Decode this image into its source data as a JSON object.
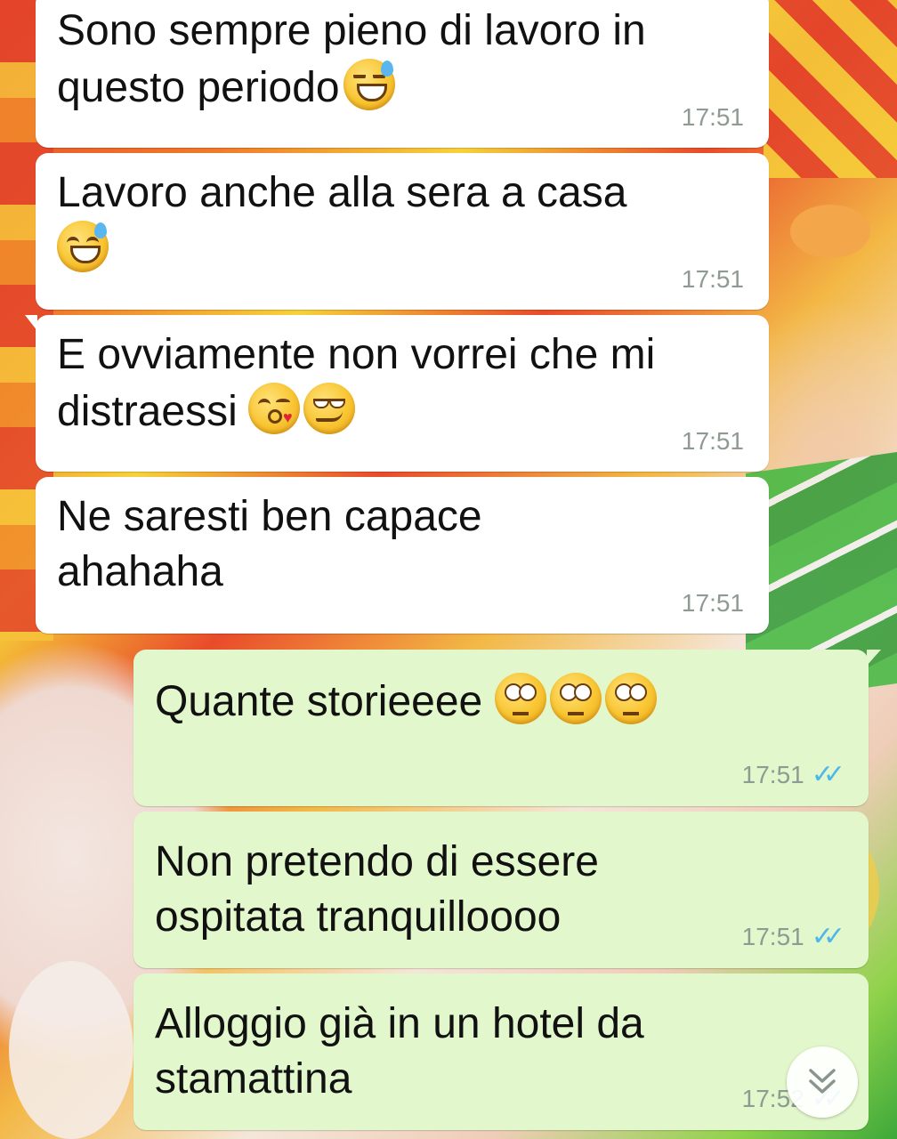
{
  "messages": [
    {
      "direction": "incoming",
      "text": "Sono sempre pieno di lavoro in\nquesto periodo",
      "emoji": [
        "sweat-smile-emoji"
      ],
      "time": "17:51"
    },
    {
      "direction": "incoming",
      "text": "Lavoro anche alla sera a casa",
      "emoji": [
        "sweat-smile-emoji"
      ],
      "time": "17:51"
    },
    {
      "direction": "incoming",
      "text": "E ovviamente non vorrei che mi\ndistraessi",
      "emoji": [
        "kissing-heart-emoji",
        "smirk-emoji"
      ],
      "time": "17:51"
    },
    {
      "direction": "incoming",
      "text": "Ne saresti ben capace\nahahaha",
      "emoji": [],
      "time": "17:51"
    },
    {
      "direction": "outgoing",
      "text": "Quante storieeee",
      "emoji": [
        "eye-roll-emoji",
        "eye-roll-emoji",
        "eye-roll-emoji"
      ],
      "time": "17:51",
      "status": "read"
    },
    {
      "direction": "outgoing",
      "text": "Non pretendo di essere\nospitata tranquilloooo",
      "emoji": [],
      "time": "17:51",
      "status": "read"
    },
    {
      "direction": "outgoing",
      "text": "Alloggio già in un hotel da\nstamattina",
      "emoji": [],
      "time": "17:52",
      "status": "read"
    }
  ],
  "colors": {
    "incoming_bubble": "#ffffff",
    "outgoing_bubble": "#e2f7cb",
    "read_ticks": "#4fb6ec",
    "timestamp": "#8f9a93"
  },
  "icons": {
    "read_receipt": "double-check-icon",
    "scroll_down": "chevron-double-down-icon"
  }
}
